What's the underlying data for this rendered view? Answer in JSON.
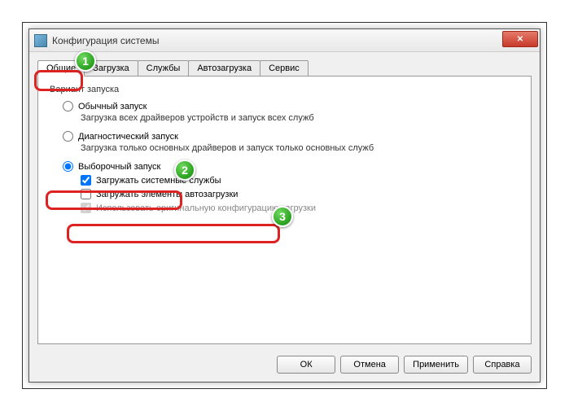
{
  "window": {
    "title": "Конфигурация системы"
  },
  "tabs": {
    "t0": "Общие",
    "t1": "Загрузка",
    "t2": "Службы",
    "t3": "Автозагрузка",
    "t4": "Сервис"
  },
  "panel": {
    "group_label": "Вариант запуска",
    "opt_normal": "Обычный запуск",
    "opt_normal_desc": "Загрузка всех драйверов устройств и запуск всех служб",
    "opt_diag": "Диагностический запуск",
    "opt_diag_desc": "Загрузка только основных драйверов и запуск только основных служб",
    "opt_selective": "Выборочный запуск",
    "chk_services": "Загружать системные службы",
    "chk_startup": "Загружать элементы автозагрузки",
    "chk_original": "Использовать оригинальную конфигурацию загрузки"
  },
  "buttons": {
    "ok": "ОК",
    "cancel": "Отмена",
    "apply": "Применить",
    "help": "Справка"
  },
  "annotations": {
    "b1": "1",
    "b2": "2",
    "b3": "3"
  }
}
